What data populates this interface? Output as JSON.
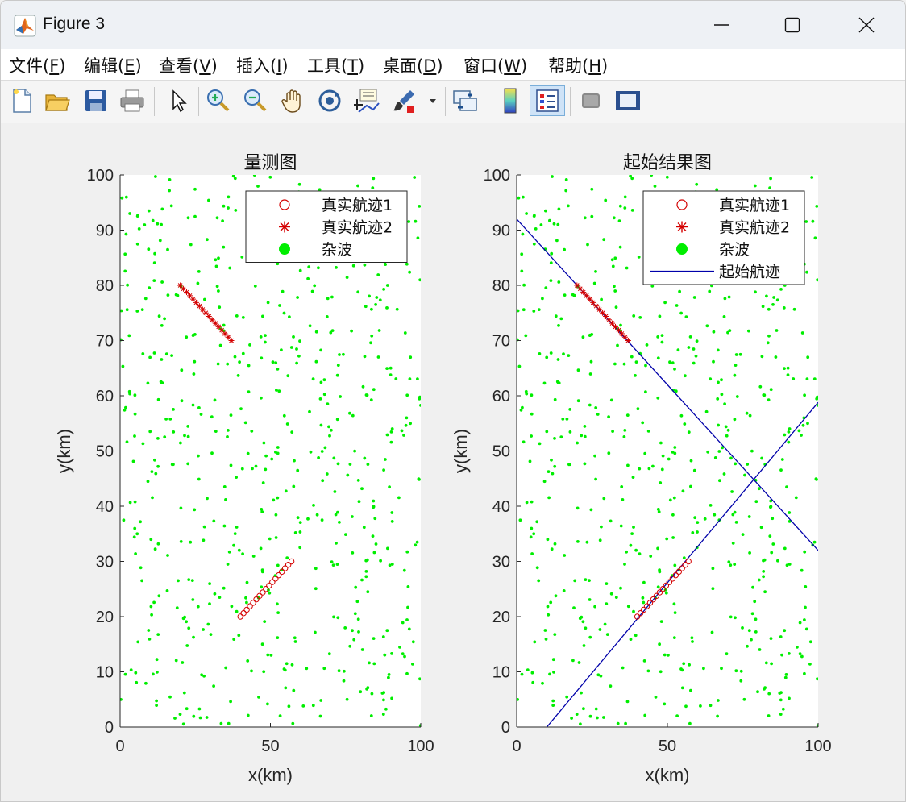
{
  "window": {
    "title": "Figure 3",
    "icons": {
      "app": "matlab-icon",
      "minimize": "minimize-icon",
      "maximize": "maximize-icon",
      "close": "close-icon"
    }
  },
  "menu": [
    {
      "label": "文件(",
      "key": "F",
      "tail": ")"
    },
    {
      "label": "编辑(",
      "key": "E",
      "tail": ")"
    },
    {
      "label": "查看(",
      "key": "V",
      "tail": ")"
    },
    {
      "label": "插入(",
      "key": "I",
      "tail": ")"
    },
    {
      "label": "工具(",
      "key": "T",
      "tail": ")"
    },
    {
      "label": "桌面(",
      "key": "D",
      "tail": ")"
    },
    {
      "label": "窗口(",
      "key": "W",
      "tail": ")"
    },
    {
      "label": "帮助(",
      "key": "H",
      "tail": ")"
    }
  ],
  "toolbar": [
    "new-figure-icon",
    "open-file-icon",
    "save-icon",
    "print-icon",
    "select-arrow-icon",
    "zoom-in-icon",
    "zoom-out-icon",
    "pan-hand-icon",
    "rotate-3d-icon",
    "data-cursor-icon",
    "brush-icon",
    "brush-dropdown-icon",
    "link-plot-icon",
    "colorbar-icon",
    "legend-icon",
    "hide-tools-icon",
    "dock-figure-icon"
  ],
  "colors": {
    "clutter": "#00ee00",
    "track": "#d40000",
    "start_line": "#0000aa"
  },
  "chart_data": [
    {
      "type": "scatter",
      "title": "量测图",
      "xlabel": "x(km)",
      "ylabel": "y(km)",
      "xlim": [
        0,
        100
      ],
      "ylim": [
        0,
        100
      ],
      "xticks": [
        "0",
        "50",
        "100"
      ],
      "yticks": [
        "0",
        "10",
        "20",
        "30",
        "40",
        "50",
        "60",
        "70",
        "80",
        "90",
        "100"
      ],
      "legend": {
        "position": "top-right",
        "entries": [
          "真实航迹1",
          "真实航迹2",
          "杂波"
        ]
      },
      "series": [
        {
          "name": "真实航迹1",
          "marker": "circle",
          "x": [
            40,
            41.06,
            42.12,
            43.19,
            44.25,
            45.31,
            46.37,
            47.44,
            48.5,
            49.56,
            50.62,
            51.69,
            52.75,
            53.81,
            54.87,
            55.94,
            57
          ],
          "y": [
            20,
            20.62,
            21.25,
            21.88,
            22.5,
            23.12,
            23.75,
            24.38,
            25,
            25.62,
            26.25,
            26.88,
            27.5,
            28.12,
            28.75,
            29.38,
            30
          ]
        },
        {
          "name": "真实航迹2",
          "marker": "asterisk",
          "x": [
            20,
            21.06,
            22.12,
            23.19,
            24.25,
            25.31,
            26.37,
            27.44,
            28.5,
            29.56,
            30.62,
            31.69,
            32.75,
            33.81,
            34.87,
            35.94,
            37
          ],
          "y": [
            80,
            79.38,
            78.75,
            78.12,
            77.5,
            76.88,
            76.25,
            75.62,
            75,
            74.38,
            73.75,
            73.12,
            72.5,
            71.88,
            71.25,
            70.62,
            70
          ]
        },
        {
          "name": "杂波",
          "marker": "dot",
          "count": 600,
          "distribution": "uniform"
        }
      ]
    },
    {
      "type": "scatter",
      "title": "起始结果图",
      "xlabel": "x(km)",
      "ylabel": "y(km)",
      "xlim": [
        0,
        100
      ],
      "ylim": [
        0,
        100
      ],
      "xticks": [
        "0",
        "50",
        "100"
      ],
      "yticks": [
        "0",
        "10",
        "20",
        "30",
        "40",
        "50",
        "60",
        "70",
        "80",
        "90",
        "100"
      ],
      "legend": {
        "position": "top-right",
        "entries": [
          "真实航迹1",
          "真实航迹2",
          "杂波",
          "起始航迹"
        ]
      },
      "series": [
        {
          "name": "真实航迹1",
          "marker": "circle",
          "x": [
            40,
            41.06,
            42.12,
            43.19,
            44.25,
            45.31,
            46.37,
            47.44,
            48.5,
            49.56,
            50.62,
            51.69,
            52.75,
            53.81,
            54.87,
            55.94,
            57
          ],
          "y": [
            20,
            20.62,
            21.25,
            21.88,
            22.5,
            23.12,
            23.75,
            24.38,
            25,
            25.62,
            26.25,
            26.88,
            27.5,
            28.12,
            28.75,
            29.38,
            30
          ]
        },
        {
          "name": "真实航迹2",
          "marker": "asterisk",
          "x": [
            20,
            21.06,
            22.12,
            23.19,
            24.25,
            25.31,
            26.37,
            27.44,
            28.5,
            29.56,
            30.62,
            31.69,
            32.75,
            33.81,
            34.87,
            35.94,
            37
          ],
          "y": [
            80,
            79.38,
            78.75,
            78.12,
            77.5,
            76.88,
            76.25,
            75.62,
            75,
            74.38,
            73.75,
            73.12,
            72.5,
            71.88,
            71.25,
            70.62,
            70
          ]
        },
        {
          "name": "杂波",
          "marker": "dot",
          "count": 600,
          "distribution": "uniform"
        },
        {
          "name": "起始航迹",
          "marker": "line",
          "lines": [
            {
              "x": [
                10,
                100
              ],
              "y": [
                0,
                58.8
              ]
            },
            {
              "x": [
                0,
                100
              ],
              "y": [
                92,
                32
              ]
            }
          ]
        }
      ]
    }
  ]
}
